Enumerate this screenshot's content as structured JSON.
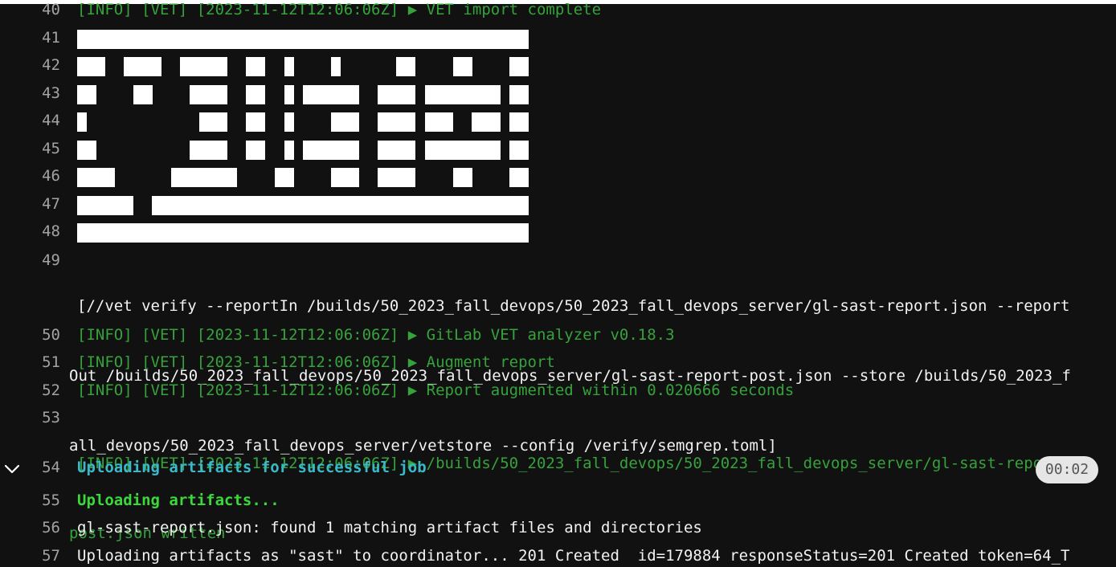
{
  "log": {
    "lines": [
      {
        "num": "40",
        "text": "[INFO] [VET] [2023-11-12T12:06:06Z] ▶ VET import complete"
      },
      {
        "num": "41"
      },
      {
        "num": "42"
      },
      {
        "num": "43"
      },
      {
        "num": "44"
      },
      {
        "num": "45"
      },
      {
        "num": "46"
      },
      {
        "num": "47"
      },
      {
        "num": "48"
      },
      {
        "num": "49",
        "text_lines": [
          "[//vet verify --reportIn /builds/50_2023_fall_devops/50_2023_fall_devops_server/gl-sast-report.json --report",
          "Out /builds/50_2023_fall_devops/50_2023_fall_devops_server/gl-sast-report-post.json --store /builds/50_2023_f",
          "all_devops/50_2023_fall_devops_server/vetstore --config /verify/semgrep.toml]"
        ]
      },
      {
        "num": "50",
        "text": "[INFO] [VET] [2023-11-12T12:06:06Z] ▶ GitLab VET analyzer v0.18.3"
      },
      {
        "num": "51",
        "text": "[INFO] [VET] [2023-11-12T12:06:06Z] ▶ Augment report"
      },
      {
        "num": "52",
        "text": "[INFO] [VET] [2023-11-12T12:06:06Z] ▶ Report augmented within 0.020666 seconds"
      },
      {
        "num": "53",
        "text_lines": [
          "[INFO] [VET] [2023-11-12T12:06:06Z] ▶ /builds/50_2023_fall_devops/50_2023_fall_devops_server/gl-sast-report-",
          "post.json written"
        ]
      },
      {
        "num": "54",
        "text": "Uploading artifacts for successful job"
      },
      {
        "num": "55",
        "text": "Uploading artifacts..."
      },
      {
        "num": "56",
        "text": "gl-sast-report.json: found 1 matching artifact files and directories"
      },
      {
        "num": "57",
        "text": "Uploading artifacts as \"sast\" to coordinator... 201 Created  id=179884 responseStatus=201 Created token=64_T"
      }
    ]
  },
  "section": {
    "timer": "00:02",
    "collapse_icon": "chevron-down-icon"
  },
  "colors": {
    "background": "#111111",
    "info_green": "#36a23b",
    "section_cyan": "#3ab8c9",
    "bright_green": "#3bd83b",
    "line_number": "#a3a3a3"
  }
}
